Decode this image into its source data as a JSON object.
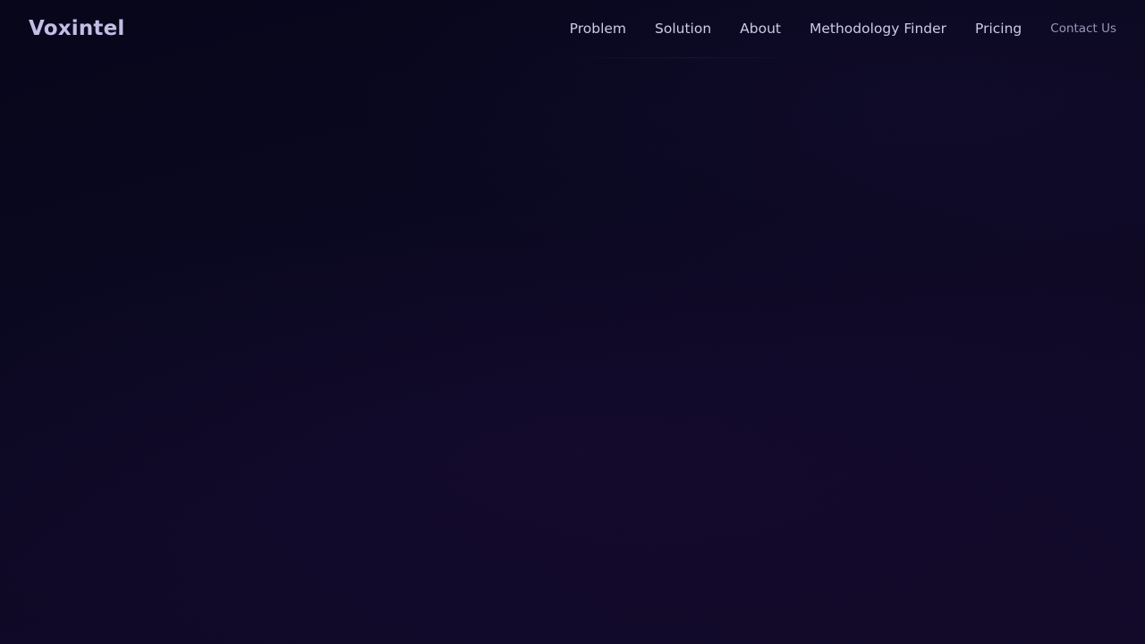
{
  "brand": {
    "name": "Voxintel"
  },
  "nav": {
    "links": [
      {
        "label": "Problem"
      },
      {
        "label": "Solution"
      },
      {
        "label": "About"
      },
      {
        "label": "Methodology Finder"
      },
      {
        "label": "Pricing"
      }
    ],
    "contact_label": "Contact Us"
  },
  "colors": {
    "background_top": "#07061a",
    "background_bottom": "#130a2a",
    "logo": "#c3bde6",
    "nav_text": "#cdc9e6",
    "contact_text": "#9a95b8"
  }
}
